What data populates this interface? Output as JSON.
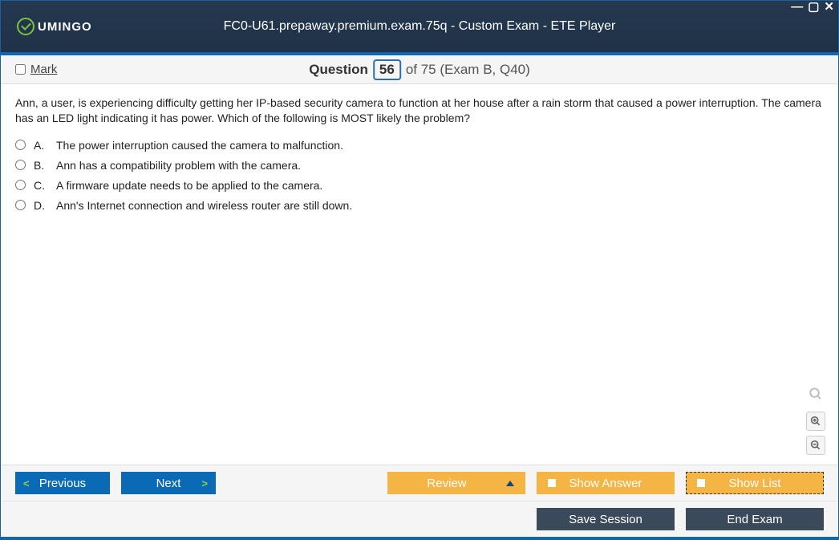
{
  "window": {
    "title": "FC0-U61.prepaway.premium.exam.75q - Custom Exam - ETE Player",
    "logo_text": "UMINGO"
  },
  "questionBar": {
    "mark_label": "Mark",
    "question_label": "Question",
    "current": "56",
    "of_total": "of 75 (Exam B, Q40)"
  },
  "question": {
    "text": "Ann, a user, is experiencing difficulty getting her IP-based security camera to function at her house after a rain storm that caused a power interruption. The camera has an LED light indicating it has power. Which of the following is MOST likely the problem?",
    "options": [
      {
        "letter": "A.",
        "text": "The power interruption caused the camera to malfunction."
      },
      {
        "letter": "B.",
        "text": "Ann has a compatibility problem with the camera."
      },
      {
        "letter": "C.",
        "text": "A firmware update needs to be applied to the camera."
      },
      {
        "letter": "D.",
        "text": "Ann's Internet connection and wireless router are still down."
      }
    ]
  },
  "buttons": {
    "previous": "Previous",
    "next": "Next",
    "review": "Review",
    "show_answer": "Show Answer",
    "show_list": "Show List",
    "save_session": "Save Session",
    "end_exam": "End Exam"
  }
}
